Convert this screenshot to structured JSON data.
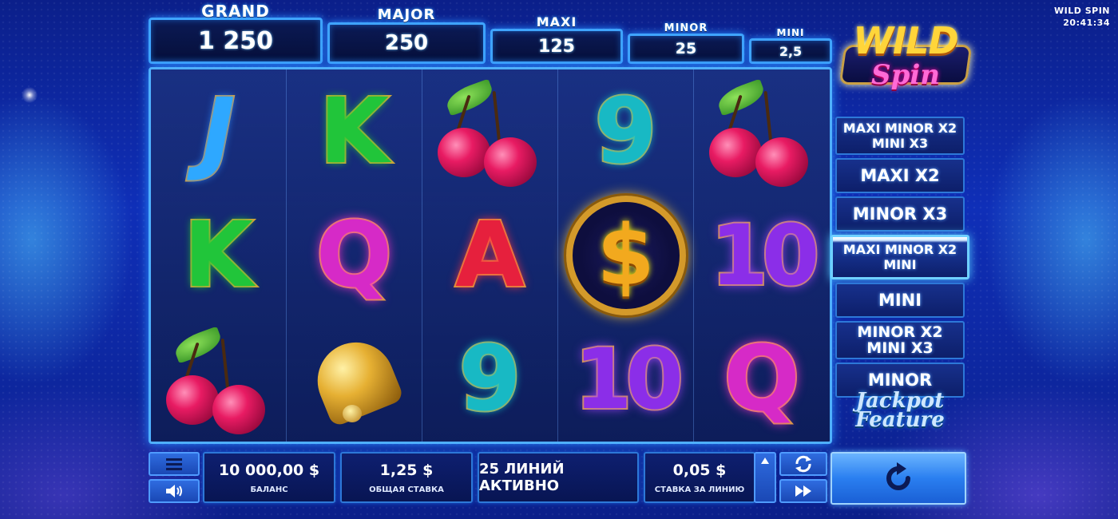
{
  "status": {
    "title": "WILD SPIN",
    "time": "20:41:34"
  },
  "jackpots": {
    "grand": {
      "label": "GRAND",
      "value": "1 250"
    },
    "major": {
      "label": "MAJOR",
      "value": "250"
    },
    "maxi": {
      "label": "MAXI",
      "value": "125"
    },
    "minor": {
      "label": "MINOR",
      "value": "25"
    },
    "mini": {
      "label": "MINI",
      "value": "2,5"
    }
  },
  "logo": {
    "line1": "WILD",
    "line2": "Spin"
  },
  "reels": [
    [
      "J",
      "K",
      "cherry"
    ],
    [
      "K",
      "Q",
      "bell"
    ],
    [
      "cherry",
      "A",
      "9"
    ],
    [
      "9",
      "dollar",
      "10"
    ],
    [
      "cherry",
      "10",
      "Q"
    ]
  ],
  "features": [
    {
      "line1": "MAXI  MINOR X2",
      "line2": "MINI X3"
    },
    {
      "line1": "MAXI X2",
      "line2": ""
    },
    {
      "line1": "MINOR X3",
      "line2": ""
    },
    {
      "line1": "MAXI  MINOR X2",
      "line2": "MINI"
    },
    {
      "line1": "MINI",
      "line2": ""
    },
    {
      "line1": "MINOR X2",
      "line2": "MINI X3"
    },
    {
      "line1": "MINOR",
      "line2": ""
    }
  ],
  "jackpot_feature": {
    "line1": "Jackpot",
    "line2": "Feature"
  },
  "bottom": {
    "balance": {
      "value": "10 000,00 $",
      "label": "БАЛАНС"
    },
    "total_bet": {
      "value": "1,25 $",
      "label": "ОБЩАЯ СТАВКА"
    },
    "lines": {
      "value": "25 ЛИНИЙ АКТИВНО"
    },
    "line_bet": {
      "value": "0,05 $",
      "label": "СТАВКА ЗА ЛИНИЮ"
    }
  },
  "icons": {
    "menu": "menu-icon",
    "sound": "speaker-icon",
    "autoplay": "refresh-icon",
    "turbo": "fast-forward-icon",
    "spin": "spin-arrow-icon",
    "increase": "chevron-up-icon"
  },
  "colors": {
    "frame": "#4fb0ff",
    "background": "#0f2fb8",
    "spin_button": "#2a7ff0"
  }
}
